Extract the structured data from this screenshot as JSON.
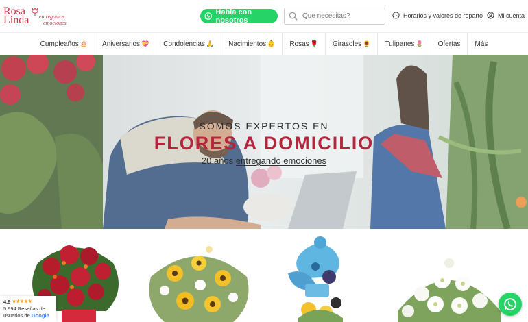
{
  "brand": {
    "name_line1": "Rosa",
    "name_line2": "Linda",
    "tagline_line1": "entregamos",
    "tagline_line2": "emociones"
  },
  "header": {
    "whatsapp_label": "Habla con nosotros",
    "search_placeholder": "Que necesitas?",
    "hours_label": "Horarios y valores de reparto",
    "account_label": "Mi cuenta"
  },
  "nav": {
    "items": [
      {
        "label": "Cumpleaños",
        "emoji": "🎂"
      },
      {
        "label": "Aniversarios",
        "emoji": "💝"
      },
      {
        "label": "Condolencias",
        "emoji": "🙏"
      },
      {
        "label": "Nacimientos",
        "emoji": "👶"
      },
      {
        "label": "Rosas",
        "emoji": "🌹"
      },
      {
        "label": "Girasoles",
        "emoji": "🌻"
      },
      {
        "label": "Tulipanes",
        "emoji": "🌷"
      },
      {
        "label": "Ofertas",
        "emoji": ""
      },
      {
        "label": "Más",
        "emoji": ""
      }
    ]
  },
  "hero": {
    "line1": "SOMOS EXPERTOS EN",
    "line2": "FLORES A DOMICILIO",
    "line3_prefix": "20 años ",
    "line3_link": "entregando emociones"
  },
  "reviews": {
    "rating": "4.9",
    "stars": "★★★★★",
    "count_text": "5.994 Reseñas de",
    "source_prefix": "usuarios de ",
    "source_brand": "Google"
  },
  "products": [
    {
      "icon": "red-roses-bouquet"
    },
    {
      "icon": "sunflower-bouquet"
    },
    {
      "icon": "baby-balloon-arrangement"
    },
    {
      "icon": "white-flower-arrangement"
    }
  ],
  "colors": {
    "brand": "#c8334a",
    "hero_accent": "#b4263d",
    "whatsapp": "#25d366",
    "star": "#f3a619"
  }
}
